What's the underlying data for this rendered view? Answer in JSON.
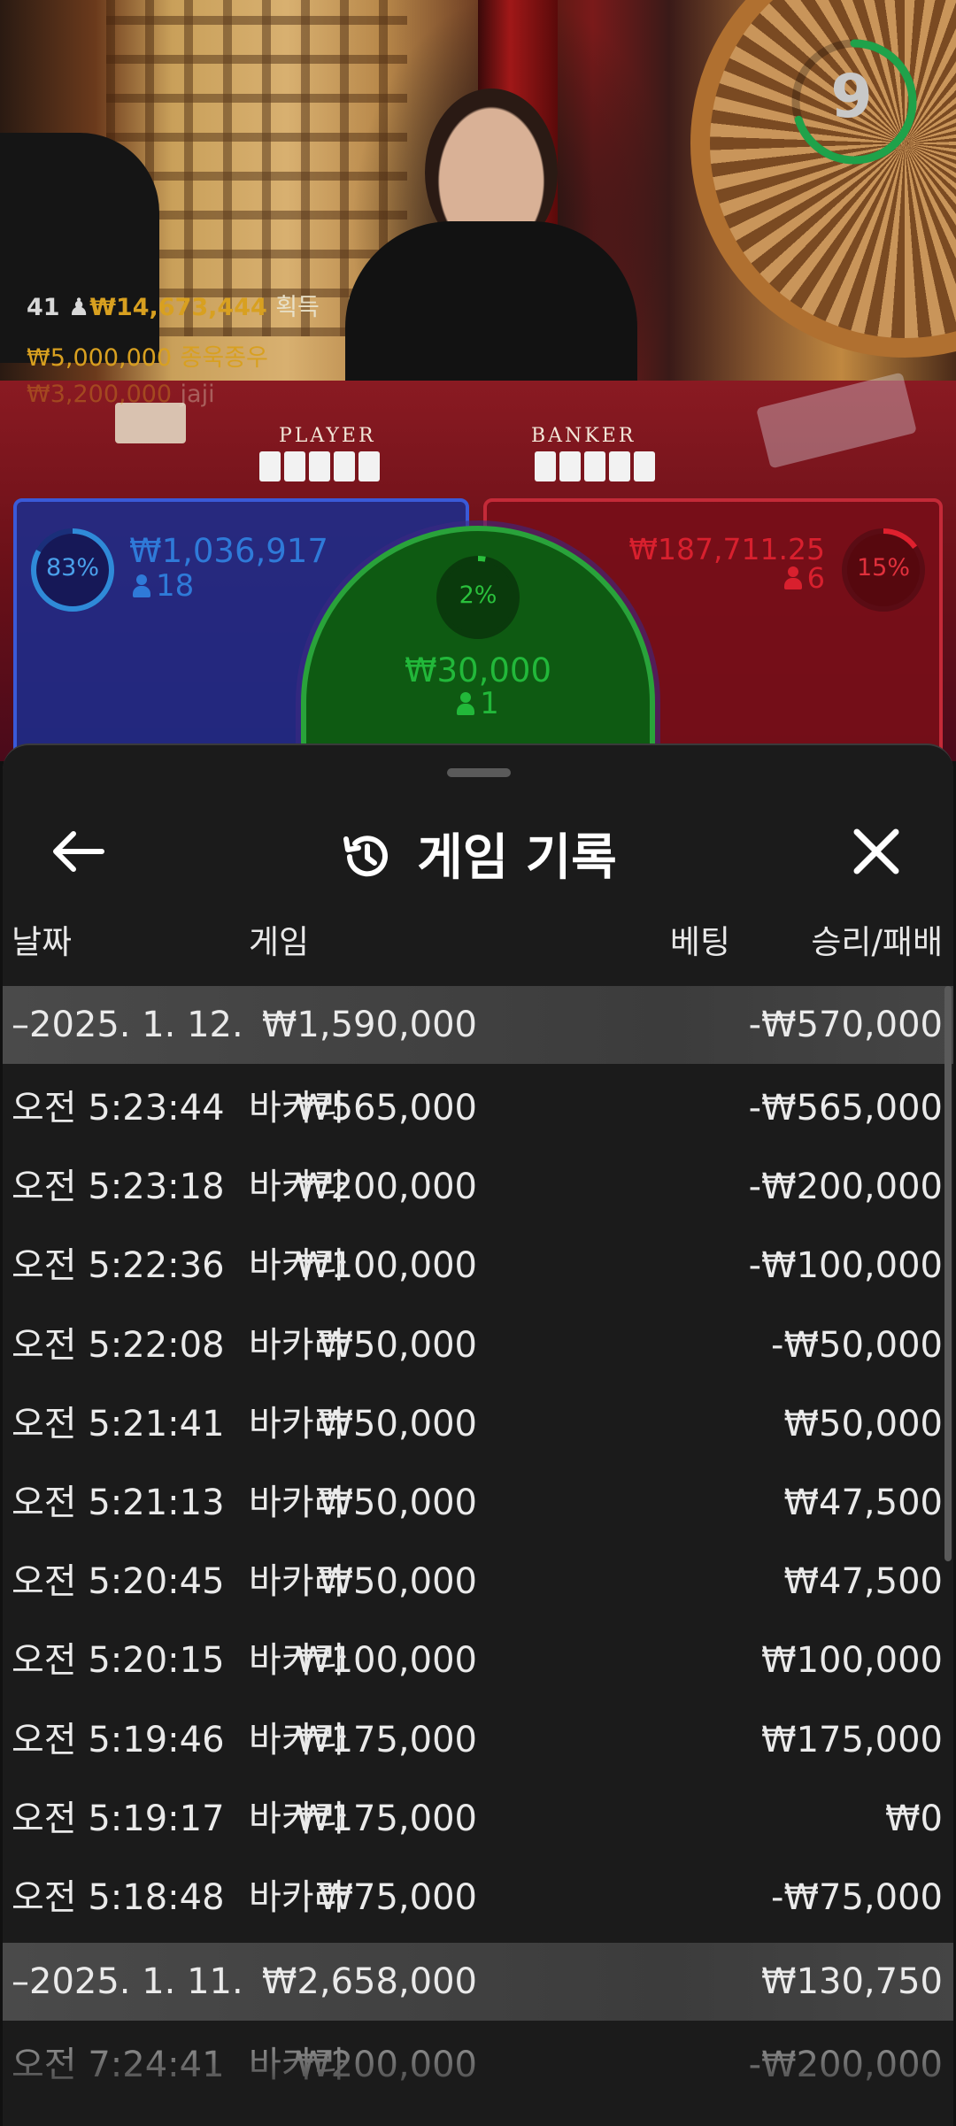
{
  "timer": {
    "value": "9",
    "progress": 0.7
  },
  "overlay_wins": [
    {
      "count": "41",
      "amount": "₩14,673,444",
      "label": "획득"
    },
    {
      "amount": "₩5,000,000",
      "label": "종욱종우"
    },
    {
      "amount": "₩3,200,000",
      "label": "jaji"
    }
  ],
  "table_labels": {
    "player": "PLAYER",
    "banker": "BANKER"
  },
  "betting": {
    "player": {
      "percent": "83%",
      "percent_value": 0.83,
      "amount": "₩1,036,917",
      "players": "18",
      "color": "#2f6fd8"
    },
    "tie": {
      "percent": "2%",
      "percent_value": 0.02,
      "amount": "₩30,000",
      "players": "1",
      "color": "#22b83a"
    },
    "banker": {
      "percent": "15%",
      "percent_value": 0.15,
      "amount": "₩187,711.25",
      "players": "6",
      "color": "#d4202e"
    }
  },
  "sheet": {
    "title": "게임 기록",
    "columns": {
      "date": "날짜",
      "game": "게임",
      "bet": "베팅",
      "result": "승리/패배"
    },
    "groups": [
      {
        "date": "2025. 1. 12.",
        "bet": "₩1,590,000",
        "result": "-₩570,000",
        "rows": [
          {
            "time": "오전 5:23:44",
            "game": "바카라",
            "bet": "₩565,000",
            "result": "-₩565,000"
          },
          {
            "time": "오전 5:23:18",
            "game": "바카라",
            "bet": "₩200,000",
            "result": "-₩200,000"
          },
          {
            "time": "오전 5:22:36",
            "game": "바카라",
            "bet": "₩100,000",
            "result": "-₩100,000"
          },
          {
            "time": "오전 5:22:08",
            "game": "바카라",
            "bet": "₩50,000",
            "result": "-₩50,000"
          },
          {
            "time": "오전 5:21:41",
            "game": "바카라",
            "bet": "₩50,000",
            "result": "₩50,000"
          },
          {
            "time": "오전 5:21:13",
            "game": "바카라",
            "bet": "₩50,000",
            "result": "₩47,500"
          },
          {
            "time": "오전 5:20:45",
            "game": "바카라",
            "bet": "₩50,000",
            "result": "₩47,500"
          },
          {
            "time": "오전 5:20:15",
            "game": "바카라",
            "bet": "₩100,000",
            "result": "₩100,000"
          },
          {
            "time": "오전 5:19:46",
            "game": "바카라",
            "bet": "₩175,000",
            "result": "₩175,000"
          },
          {
            "time": "오전 5:19:17",
            "game": "바카라",
            "bet": "₩175,000",
            "result": "₩0"
          },
          {
            "time": "오전 5:18:48",
            "game": "바카라",
            "bet": "₩75,000",
            "result": "-₩75,000"
          }
        ]
      },
      {
        "date": "2025. 1. 11.",
        "bet": "₩2,658,000",
        "result": "₩130,750",
        "rows": [
          {
            "time": "오전 7:24:41",
            "game": "바카라",
            "bet": "₩200,000",
            "result": "-₩200,000"
          }
        ]
      }
    ]
  }
}
